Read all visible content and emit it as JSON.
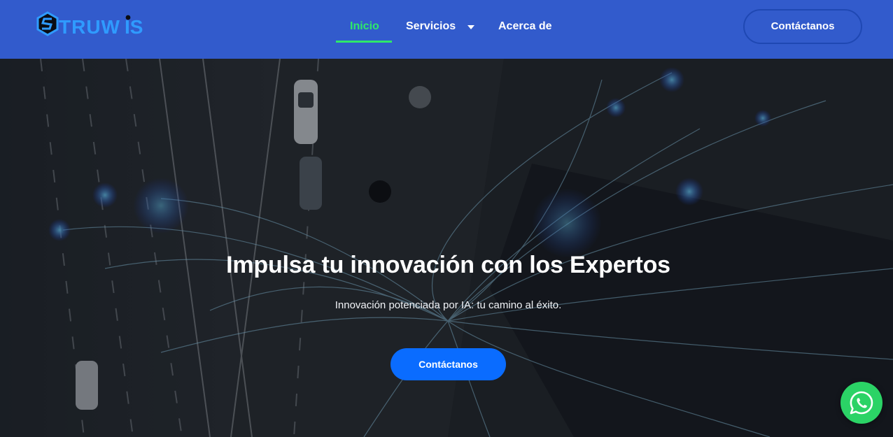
{
  "brand": {
    "name": "STRUWIS"
  },
  "nav": {
    "items": [
      {
        "label": "Inicio",
        "active": true
      },
      {
        "label": "Servicios",
        "has_dropdown": true
      },
      {
        "label": "Acerca de"
      }
    ]
  },
  "header": {
    "cta_label": "Contáctanos"
  },
  "hero": {
    "title": "Impulsa tu innovación con los Expertos",
    "subtitle": "Innovación potenciada por IA: tu camino al éxito.",
    "cta_label": "Contáctanos"
  },
  "floating": {
    "icon": "whatsapp-icon"
  },
  "colors": {
    "header_bg": "#325bcc",
    "active_nav": "#2ee86a",
    "cta_blue": "#0a6cff",
    "whatsapp_green": "#2bd366"
  }
}
